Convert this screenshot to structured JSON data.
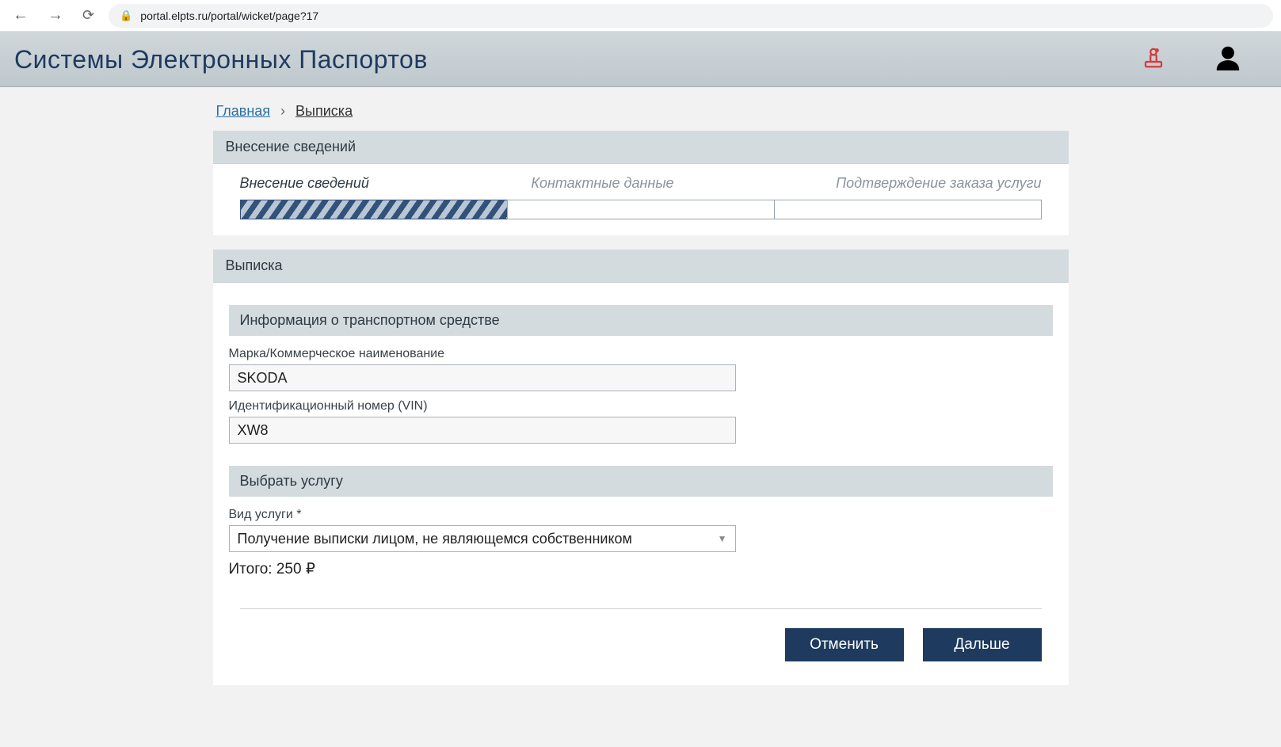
{
  "browser": {
    "url": "portal.elpts.ru/portal/wicket/page?17"
  },
  "header": {
    "title": "Системы Электронных Паспортов"
  },
  "breadcrumb": {
    "home": "Главная",
    "current": "Выписка"
  },
  "wizard": {
    "title": "Внесение сведений",
    "steps": {
      "s1": "Внесение сведений",
      "s2": "Контактные данные",
      "s3": "Подтверждение заказа услуги"
    }
  },
  "form": {
    "section_title": "Выписка",
    "vehicle_section": "Информация о транспортном средстве",
    "brand_label": "Марка/Коммерческое наименование",
    "brand_value": "SKODA",
    "vin_label": "Идентификационный номер (VIN)",
    "vin_value": "XW8",
    "service_section": "Выбрать услугу",
    "service_type_label": "Вид услуги *",
    "service_type_value": "Получение выписки лицом, не являющемся собственником",
    "total_label": "Итого: 250 ₽"
  },
  "actions": {
    "cancel": "Отменить",
    "next": "Дальше"
  }
}
